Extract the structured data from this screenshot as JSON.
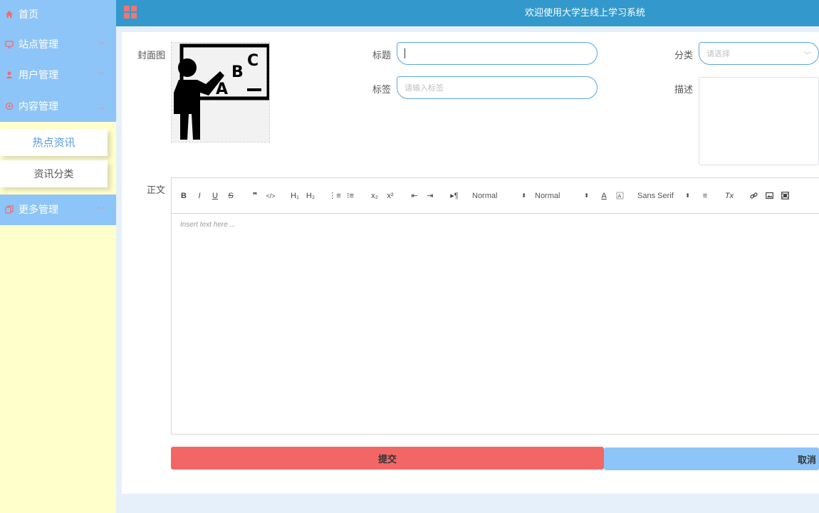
{
  "header": {
    "title": "欢迎使用大学生线上学习系统"
  },
  "sidebar": {
    "items": [
      {
        "label": "首页",
        "icon": "home-icon"
      },
      {
        "label": "站点管理",
        "icon": "monitor-icon"
      },
      {
        "label": "用户管理",
        "icon": "user-icon"
      },
      {
        "label": "内容管理",
        "icon": "target-icon"
      }
    ],
    "submenu": [
      {
        "label": "热点资讯",
        "active": true
      },
      {
        "label": "资讯分类",
        "active": false
      }
    ],
    "more": {
      "label": "更多管理",
      "icon": "copy-icon"
    }
  },
  "form": {
    "cover_label": "封面图",
    "title_label": "标题",
    "title_value": "",
    "category_label": "分类",
    "category_placeholder": "请选择",
    "tags_label": "标签",
    "tags_placeholder": "请输入标签",
    "desc_label": "描述",
    "body_label": "正文",
    "editor": {
      "toolbar": {
        "bold": "B",
        "italic": "I",
        "underline": "U",
        "strike": "S",
        "blockquote": "❞",
        "code": "</>",
        "h1": "H₁",
        "h2": "H₂",
        "ordered_list": "⋮≡",
        "bullet_list": "⁝≡",
        "sub": "x₂",
        "sup": "x²",
        "outdent": "⇤",
        "indent": "⇥",
        "direction": "▸¶",
        "size_picker": "Normal",
        "header_picker": "Normal",
        "font_color": "A",
        "font_picker": "Sans Serif",
        "align": "≡",
        "clean": "Tx"
      },
      "placeholder": "Insert text here ..."
    },
    "submit_label": "提交",
    "cancel_label": "取消"
  },
  "colors": {
    "header": "#3399cc",
    "sidebar_menu": "#8ec5f8",
    "sidebar_bg": "#ffffcc",
    "submit": "#f26666",
    "cancel": "#8ec5f8",
    "input_border": "#5aa6e0"
  }
}
